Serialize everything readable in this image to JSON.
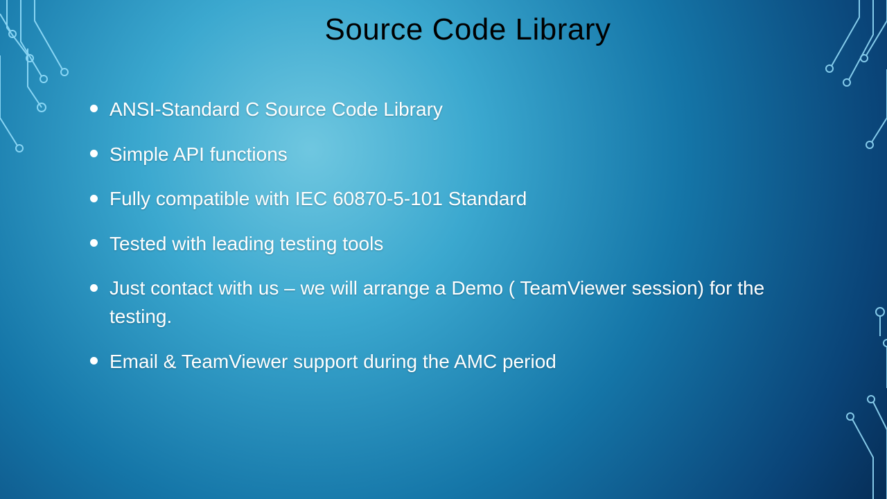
{
  "title": "Source Code Library",
  "bullets": [
    "ANSI-Standard C Source Code Library",
    "Simple API functions",
    "Fully compatible with IEC 60870-5-101 Standard",
    "Tested with leading testing tools",
    "Just contact with us – we will arrange a Demo ( TeamViewer session) for the testing.",
    "Email & TeamViewer support during the AMC period"
  ]
}
